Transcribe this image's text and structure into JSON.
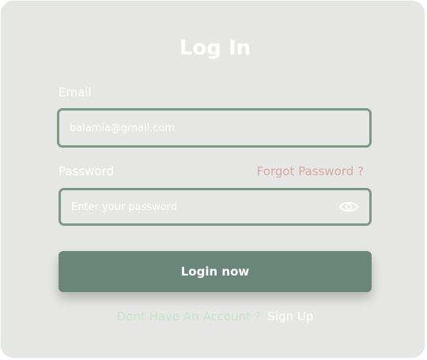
{
  "form": {
    "title": "Log In",
    "email": {
      "label": "Email",
      "value": "",
      "placeholder": "balamia@gmail.com"
    },
    "password": {
      "label": "Password",
      "value": "",
      "placeholder": "Enter your password",
      "forgot_label": "Forgot Password ?",
      "toggle_icon": "eye-icon"
    },
    "submit_label": "Login now",
    "signup_prompt": "Dont Have An Account ?",
    "signup_link": "Sign Up"
  },
  "colors": {
    "card_bg": "#e6e7e5",
    "field_border": "#7a9a86",
    "button_bg": "#6a857a",
    "forgot_text": "#d3a7a4",
    "signup_prompt_text": "#c4e5c3"
  }
}
